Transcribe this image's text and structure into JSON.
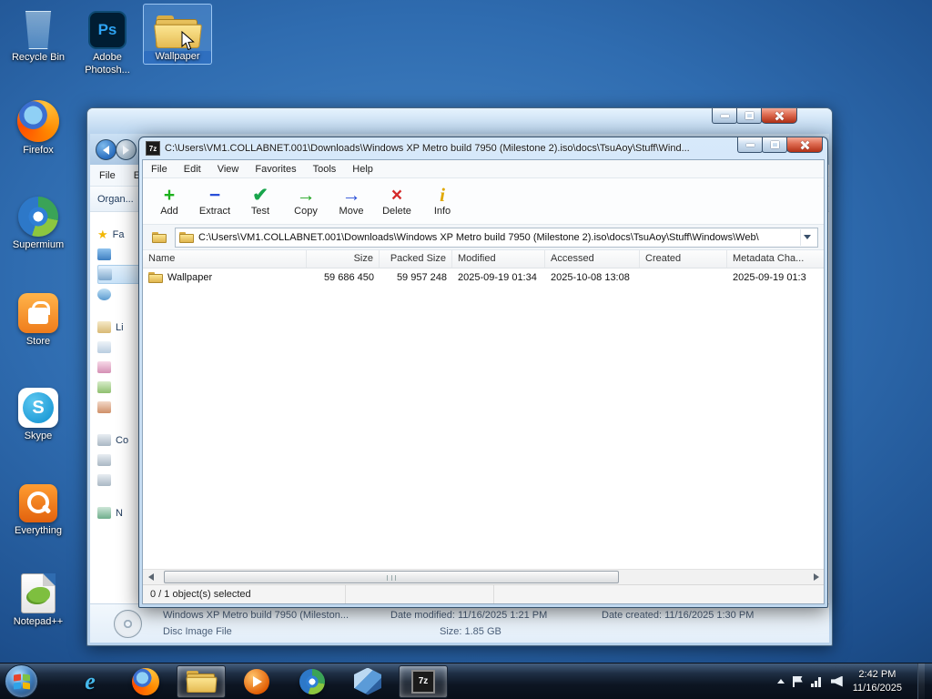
{
  "desktop": {
    "icons": [
      {
        "label": "Recycle Bin"
      },
      {
        "label": "Adobe Photosh...",
        "badge": "Ps"
      },
      {
        "label": "Wallpaper"
      },
      {
        "label": "Firefox"
      },
      {
        "label": "Supermium"
      },
      {
        "label": "Store"
      },
      {
        "label": "Skype",
        "badge": "S"
      },
      {
        "label": "Everything"
      },
      {
        "label": "Notepad++"
      }
    ]
  },
  "explorer": {
    "menu": [
      "File",
      "E"
    ],
    "organize_label": "Organ...",
    "nav_groups": [
      "Fa",
      "Li",
      "Co",
      "N"
    ],
    "details": {
      "file_title": "Windows XP Metro build 7950 (Mileston...",
      "date_modified": "Date modified: 11/16/2025 1:21 PM",
      "date_created": "Date created: 11/16/2025 1:30 PM",
      "file_type": "Disc Image File",
      "size": "Size: 1.85 GB"
    }
  },
  "sevenzip": {
    "app_icon_text": "7z",
    "title": "C:\\Users\\VM1.COLLABNET.001\\Downloads\\Windows XP Metro build 7950 (Milestone 2).iso\\docs\\TsuAoy\\Stuff\\Wind...",
    "menu": [
      "File",
      "Edit",
      "View",
      "Favorites",
      "Tools",
      "Help"
    ],
    "toolbar": [
      {
        "label": "Add",
        "glyph": "+"
      },
      {
        "label": "Extract",
        "glyph": "−"
      },
      {
        "label": "Test",
        "glyph": "✔"
      },
      {
        "label": "Copy",
        "glyph": "→"
      },
      {
        "label": "Move",
        "glyph": "→"
      },
      {
        "label": "Delete",
        "glyph": "×"
      },
      {
        "label": "Info",
        "glyph": "i"
      }
    ],
    "address": "C:\\Users\\VM1.COLLABNET.001\\Downloads\\Windows XP Metro build 7950 (Milestone 2).iso\\docs\\TsuAoy\\Stuff\\Windows\\Web\\",
    "columns": [
      "Name",
      "Size",
      "Packed Size",
      "Modified",
      "Accessed",
      "Created",
      "Metadata Cha..."
    ],
    "rows": [
      {
        "name": "Wallpaper",
        "size": "59 686 450",
        "packed_size": "59 957 248",
        "modified": "2025-09-19 01:34",
        "accessed": "2025-10-08 13:08",
        "created": "",
        "metadata_changed": "2025-09-19 01:3"
      }
    ],
    "status": "0 / 1 object(s) selected"
  },
  "taskbar": {
    "ie_glyph": "e",
    "clock_time": "2:42 PM",
    "clock_date": "11/16/2025"
  },
  "icons": {
    "favorites_star": "★"
  }
}
